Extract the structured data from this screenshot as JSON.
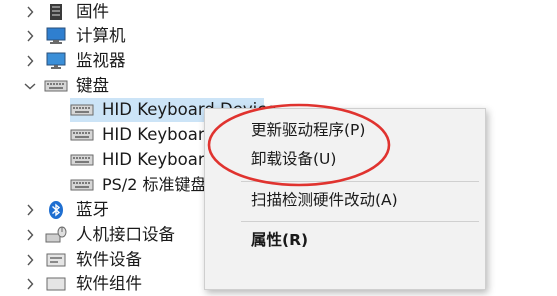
{
  "tree": {
    "items": [
      {
        "label": "固件",
        "icon": "firmware-icon",
        "expander": "chevron-right-icon"
      },
      {
        "label": "计算机",
        "icon": "computer-icon",
        "expander": "chevron-right-icon"
      },
      {
        "label": "监视器",
        "icon": "monitor-icon",
        "expander": "chevron-right-icon"
      },
      {
        "label": "键盘",
        "icon": "keyboard-icon",
        "expander": "chevron-down-icon"
      },
      {
        "label": "HID Keyboard Device",
        "icon": "keyboard-icon"
      },
      {
        "label": "HID Keyboard Device",
        "icon": "keyboard-icon"
      },
      {
        "label": "HID Keyboard Device",
        "icon": "keyboard-icon"
      },
      {
        "label": "PS/2 标准键盘",
        "icon": "keyboard-icon"
      },
      {
        "label": "蓝牙",
        "icon": "bluetooth-icon",
        "expander": "chevron-right-icon"
      },
      {
        "label": "人机接口设备",
        "icon": "hid-icon",
        "expander": "chevron-right-icon"
      },
      {
        "label": "软件设备",
        "icon": "software-device-icon",
        "expander": "chevron-right-icon"
      },
      {
        "label": "软件组件",
        "icon": "software-component-icon",
        "expander": "chevron-right-icon"
      }
    ]
  },
  "context_menu": {
    "update_driver": "更新驱动程序(P)",
    "uninstall_device": "卸载设备(U)",
    "scan_hardware": "扫描检测硬件改动(A)",
    "properties": "属性(R)"
  },
  "colors": {
    "selection": "#cce4f7",
    "annotation_ellipse": "#e0332f",
    "menu_background": "#f2f2f2",
    "bluetooth": "#1f6fd1",
    "monitor": "#3b8fd8"
  }
}
